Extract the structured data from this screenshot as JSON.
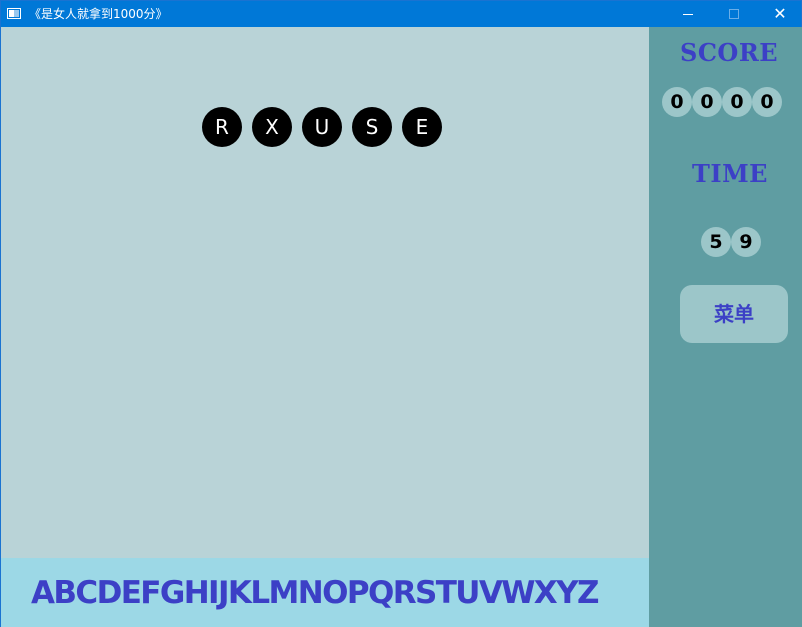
{
  "window": {
    "title": "《是女人就拿到1000分》",
    "buttons": {
      "minimize": "minimize",
      "maximize": "maximize",
      "close": "✕"
    }
  },
  "game": {
    "falling_letters": [
      "R",
      "X",
      "U",
      "S",
      "E"
    ],
    "alphabet": "ABCDEFGHIJKLMNOPQRSTUVWXYZ"
  },
  "side_panel": {
    "score_label": "SCORE",
    "score_digits": [
      "0",
      "0",
      "0",
      "0"
    ],
    "time_label": "TIME",
    "time_digits": [
      "5",
      "9"
    ],
    "menu_label": "菜单"
  },
  "colors": {
    "play_area": "#b9d3d7",
    "alphabet_bar": "#9cd8e6",
    "side_panel": "#5f9da2",
    "accent_text": "#3c40c6",
    "title_bar": "#0078d7"
  }
}
